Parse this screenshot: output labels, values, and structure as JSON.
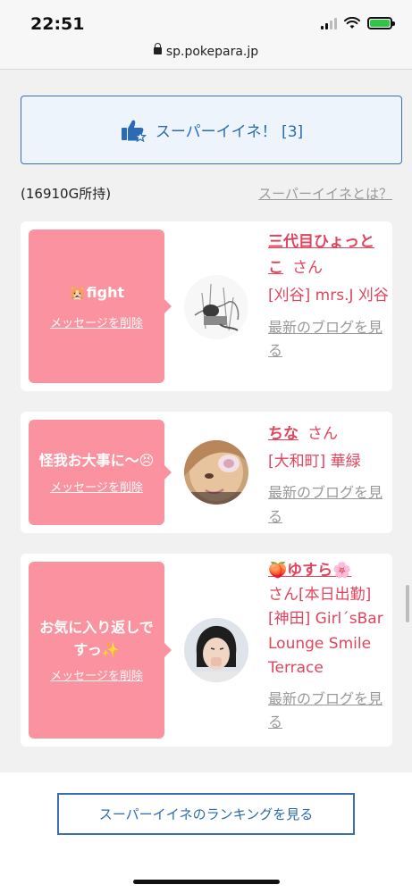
{
  "status_bar": {
    "time": "22:51",
    "url": "sp.pokepara.jp"
  },
  "super_like": {
    "label": "スーパーイイネ！ [3]",
    "icon": "thumbs-up-star-icon"
  },
  "points_text": "(16910G所持)",
  "what_link": "スーパーイイネとは？",
  "cards": [
    {
      "message": "🐹fight",
      "delete_label": "メッセージを削除",
      "name": "三代目ひょっとこ",
      "honorific": "さん",
      "shop": "[刈谷] mrs.J 刈谷",
      "blog_link": "最新のブログを見る"
    },
    {
      "message": "怪我お大事に〜😣",
      "delete_label": "メッセージを削除",
      "name": "ちな",
      "honorific": "さん",
      "shop": "[大和町] 華緑",
      "blog_link": "最新のブログを見る"
    },
    {
      "message": "お気に入り返しですっ✨",
      "delete_label": "メッセージを削除",
      "name": "🍑ゆすら🌸",
      "honorific": "さん[本日出勤]",
      "shop": "[神田] Girl´sBar Lounge Smile Terrace",
      "blog_link": "最新のブログを見る"
    }
  ],
  "ranking_button": "スーパーイイネのランキングを見る",
  "colors": {
    "accent_blue": "#2b6bb3",
    "pink": "#fa939f",
    "name_red": "#e0455d",
    "battery_green": "#35c24a"
  }
}
